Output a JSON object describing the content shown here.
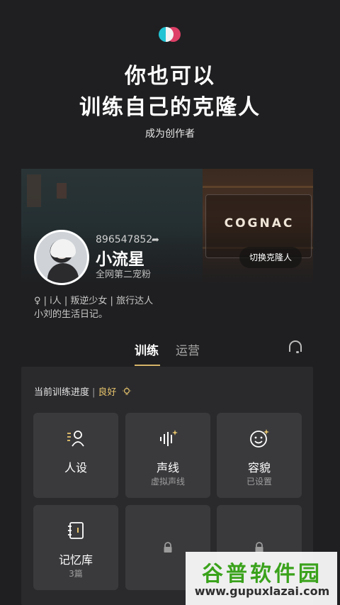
{
  "hero": {
    "line1": "你也可以",
    "line2": "训练自己的克隆人",
    "subtitle": "成为创作者"
  },
  "banner": {
    "sign_text": "COGNAC"
  },
  "profile": {
    "id": "896547852",
    "name": "小流星",
    "rank": "全网第二宠粉",
    "switch_label": "切换克隆人",
    "tags": "♀ | i人 | 叛逆少女 | 旅行达人",
    "bio": "小刘的生活日记。"
  },
  "tabs": [
    {
      "label": "训练",
      "active": true
    },
    {
      "label": "运营",
      "active": false
    }
  ],
  "progress": {
    "label": "当前训练进度",
    "separator": "|",
    "status": "良好"
  },
  "cards": [
    {
      "label": "人设",
      "sub": ""
    },
    {
      "label": "声线",
      "sub": "虚拟声线"
    },
    {
      "label": "容貌",
      "sub": "已设置"
    },
    {
      "label": "记忆库",
      "sub": "3篇"
    }
  ],
  "watermark": {
    "title": "谷普软件园",
    "url": "www.gupuxlazai.com"
  },
  "colors": {
    "background": "#1f1f21",
    "panel": "#2a2a2d",
    "card": "#3a3a3d",
    "accent_gold": "#d6b46a",
    "logo_cyan": "#22c4d4",
    "logo_pink": "#e8416a"
  },
  "icons": {
    "logo": "app-logo",
    "share": "share-arrow-icon",
    "headset": "headset-icon",
    "bulb": "bulb-icon",
    "persona": "persona-icon",
    "voice": "voice-wave-icon",
    "face": "face-icon",
    "memory": "notebook-icon",
    "lock": "lock-icon"
  }
}
